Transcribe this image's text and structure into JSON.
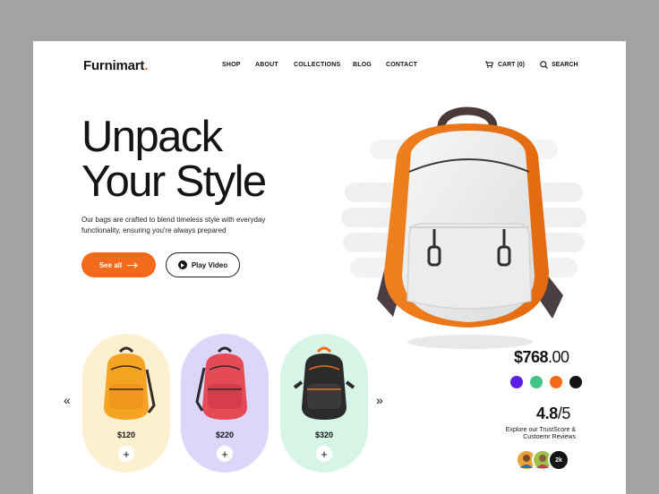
{
  "brand": {
    "name": "Furnimart",
    "dot": ".",
    "accent": "#f26a1b"
  },
  "nav": {
    "items": [
      "SHOP",
      "ABOUT",
      "COLLECTIONS",
      "BLOG",
      "CONTACT"
    ]
  },
  "header": {
    "cart_label": "CART (0)",
    "search_label": "SEARCH"
  },
  "hero": {
    "title_line1": "Unpack",
    "title_line2": "Your Style",
    "description": "Our bags are crafted to blend timeless style with everyday functionality, ensuring you're always prepared",
    "primary_button": "See all",
    "secondary_button": "Play Video"
  },
  "products": [
    {
      "price": "$120",
      "bg": "#fdf0cf",
      "bag_color": "#f5a323"
    },
    {
      "price": "$220",
      "bg": "#ddd6fb",
      "bag_color": "#e54b57"
    },
    {
      "price": "$320",
      "bg": "#d6f5e6",
      "bag_color": "#2b2b2b"
    }
  ],
  "featured": {
    "price_main": "$768",
    "price_cents": ".00",
    "colors": [
      "#5b1fe0",
      "#45c487",
      "#f26a1b",
      "#141414"
    ],
    "rating": "4.8",
    "rating_max": "/5",
    "trust_text": "Explore our TrustScore & Custoemr Reviews",
    "reviews_count": "2k"
  },
  "icons": {
    "prev": "chevron-left-double-icon",
    "next": "chevron-right-double-icon",
    "cart": "cart-icon",
    "search": "search-icon",
    "play": "play-icon",
    "arrow": "arrow-right-icon",
    "add": "plus-icon"
  }
}
